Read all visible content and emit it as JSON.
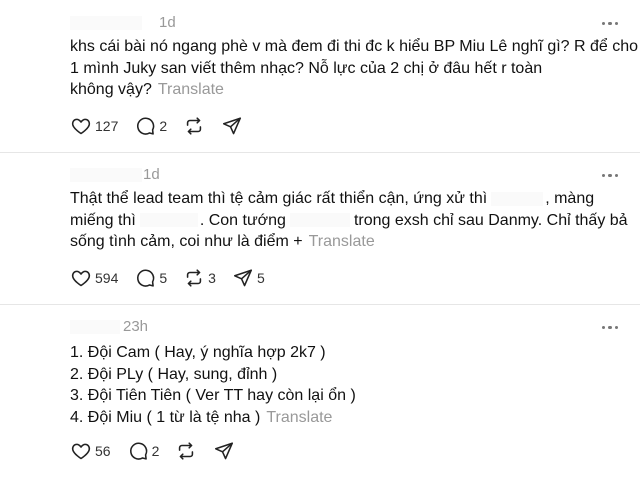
{
  "posts": [
    {
      "time": "1d",
      "lines": [
        "khs cái bài nó ngang phè v mà đem đi thi đc k hiểu BP Miu Lê nghĩ gì? R để cho",
        "1 mình Juky san viết thêm nhạc? Nỗ lực của 2 chị ở đâu hết r toàn",
        "không vậy?"
      ],
      "translate": "Translate",
      "likes": "127",
      "comments": "2",
      "reposts": "",
      "shares": ""
    },
    {
      "time": "1d",
      "line1_a": "Thật thể lead team thì tệ cảm giác rất thiển cận, ứng xử thì",
      "line1_b": ", màng",
      "line2_a": "miếng thì",
      "line2_b": ". Con tướng",
      "line2_c": "trong exsh chỉ sau Danmy. Chỉ thấy bả",
      "line3": "sống tình cảm, coi như là điểm +",
      "translate": "Translate",
      "likes": "594",
      "comments": "5",
      "reposts": "3",
      "shares": "5"
    },
    {
      "time": "23h",
      "lines": [
        "1. Đội Cam ( Hay, ý nghĩa hợp 2k7 )",
        "2. Đội PLy ( Hay, sung, đỉnh )",
        "3. Đội Tiên Tiên ( Ver TT hay còn lại ổn )",
        "4. Đội Miu ( 1 từ là tệ nha )"
      ],
      "translate": "Translate",
      "likes": "56",
      "comments": "2",
      "reposts": "",
      "shares": ""
    }
  ],
  "icons": {
    "like": "heart-icon",
    "comment": "comment-bubble-icon",
    "repost": "repost-arrows-icon",
    "share": "send-plane-icon",
    "more": "more-dots-icon"
  },
  "colors": {
    "text": "#111111",
    "muted": "#999999",
    "divider": "#e6e6e6"
  }
}
